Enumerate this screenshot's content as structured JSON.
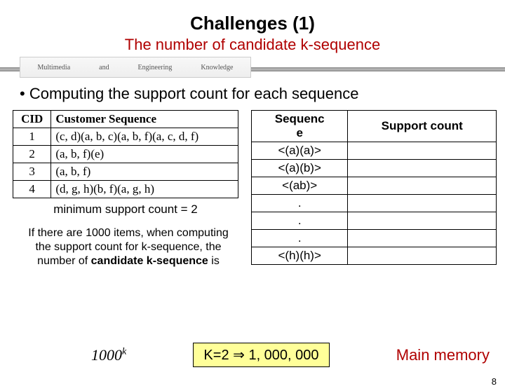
{
  "title": "Challenges (1)",
  "subtitle": "The number of candidate k-sequence",
  "logo": {
    "w1": "Multimedia",
    "w2": "and",
    "w3": "Engineering",
    "w4": "Knowledge"
  },
  "bullet": "•  Computing the support count for each sequence",
  "cidTable": {
    "headers": {
      "c1": "CID",
      "c2": "Customer Sequence"
    },
    "rows": [
      {
        "cid": "1",
        "seq": "(c, d)(a, b, c)(a, b, f)(a, c, d, f)"
      },
      {
        "cid": "2",
        "seq": "(a, b, f)(e)"
      },
      {
        "cid": "3",
        "seq": "(a, b, f)"
      },
      {
        "cid": "4",
        "seq": "(d, g, h)(b, f)(a, g, h)"
      }
    ]
  },
  "minSupport": "minimum support count = 2",
  "note": {
    "l1": "If there are 1000 items, when computing",
    "l2": "the support count for k-sequence, the",
    "l3_pre": "number of ",
    "l3_bold": "candidate k-sequence",
    "l3_post": " is"
  },
  "seqTable": {
    "headers": {
      "c1": "Sequenc\ne",
      "c2": "Support count"
    },
    "rows": [
      "<(a)(a)>",
      "<(a)(b)>",
      "<(ab)>",
      ".",
      ".",
      ".",
      "<(h)(h)>"
    ]
  },
  "formula": {
    "base": "1000",
    "exp": "k"
  },
  "k2": {
    "left": "K=2 ",
    "arrow": "⇒",
    "right": " 1, 000, 000"
  },
  "mainMemory": "Main memory",
  "pageNum": "8"
}
